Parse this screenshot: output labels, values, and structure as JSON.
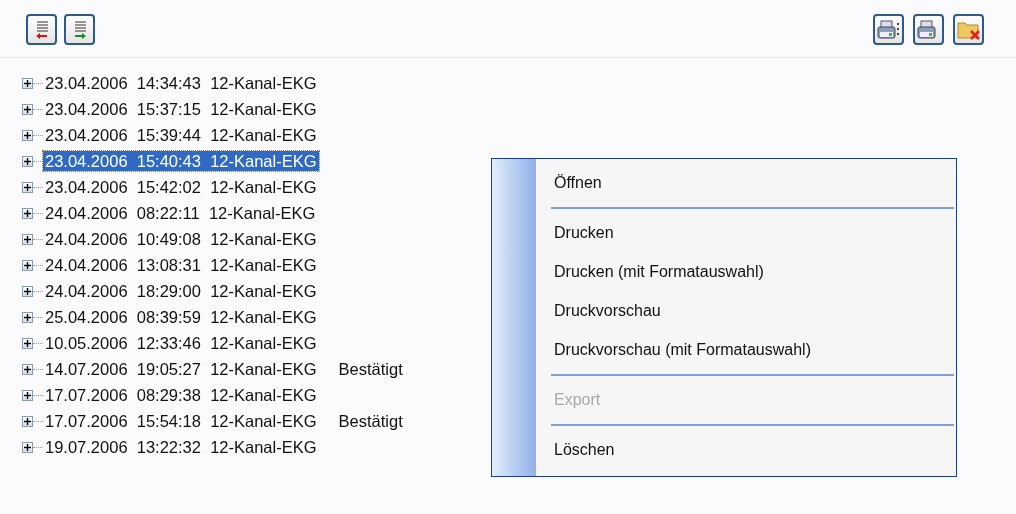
{
  "toolbar_left": [
    {
      "kind": "collapse"
    },
    {
      "kind": "expand"
    }
  ],
  "toolbar_right": [
    {
      "kind": "print-list"
    },
    {
      "kind": "print"
    },
    {
      "kind": "delete-folder"
    }
  ],
  "tree": [
    {
      "label": "23.04.2006  14:34:43  12-Kanal-EKG",
      "selected": false,
      "expanded": false
    },
    {
      "label": "23.04.2006  15:37:15  12-Kanal-EKG",
      "selected": false,
      "expanded": false
    },
    {
      "label": "23.04.2006  15:39:44  12-Kanal-EKG",
      "selected": false,
      "expanded": false
    },
    {
      "label": "23.04.2006  15:40:43  12-Kanal-EKG",
      "selected": true,
      "expanded": false
    },
    {
      "label": "23.04.2006  15:42:02  12-Kanal-EKG",
      "selected": false,
      "expanded": false
    },
    {
      "label": "24.04.2006  08:22:11  12-Kanal-EKG",
      "selected": false,
      "expanded": false
    },
    {
      "label": "24.04.2006  10:49:08  12-Kanal-EKG",
      "selected": false,
      "expanded": false
    },
    {
      "label": "24.04.2006  13:08:31  12-Kanal-EKG",
      "selected": false,
      "expanded": false
    },
    {
      "label": "24.04.2006  18:29:00  12-Kanal-EKG",
      "selected": false,
      "expanded": false
    },
    {
      "label": "25.04.2006  08:39:59  12-Kanal-EKG",
      "selected": false,
      "expanded": false
    },
    {
      "label": "10.05.2006  12:33:46  12-Kanal-EKG",
      "selected": false,
      "expanded": false
    },
    {
      "label": "14.07.2006  19:05:27  12-Kanal-EKG",
      "status": "Bestätigt",
      "selected": false,
      "expanded": false
    },
    {
      "label": "17.07.2006  08:29:38  12-Kanal-EKG",
      "selected": false,
      "expanded": false
    },
    {
      "label": "17.07.2006  15:54:18  12-Kanal-EKG",
      "status": "Bestätigt",
      "selected": false,
      "expanded": false
    },
    {
      "label": "19.07.2006  13:22:32  12-Kanal-EKG",
      "selected": false,
      "expanded": false
    }
  ],
  "context_menu": [
    {
      "kind": "item",
      "label": "Öffnen",
      "disabled": false
    },
    {
      "kind": "separator"
    },
    {
      "kind": "item",
      "label": "Drucken",
      "disabled": false
    },
    {
      "kind": "item",
      "label": "Drucken (mit Formatauswahl)",
      "disabled": false
    },
    {
      "kind": "item",
      "label": "Druckvorschau",
      "disabled": false
    },
    {
      "kind": "item",
      "label": "Druckvorschau (mit Formatauswahl)",
      "disabled": false
    },
    {
      "kind": "separator"
    },
    {
      "kind": "item",
      "label": "Export",
      "disabled": true
    },
    {
      "kind": "separator"
    },
    {
      "kind": "item",
      "label": "Löschen",
      "disabled": false
    }
  ]
}
